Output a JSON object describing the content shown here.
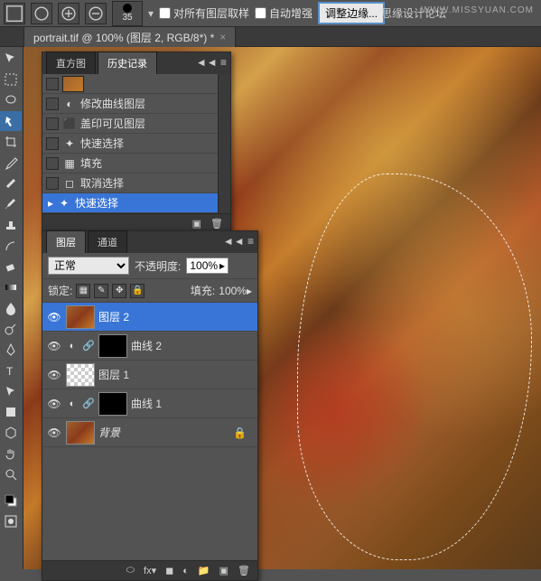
{
  "options_bar": {
    "brush_size": "35",
    "sample_all": "对所有图层取样",
    "auto_enhance": "自动增强",
    "refine_edge": "调整边缘..."
  },
  "document_tab": {
    "title": "portrait.tif @ 100% (图层 2, RGB/8*) *"
  },
  "watermark": {
    "site": "WWW.MISSYUAN.COM",
    "forum": "思缘设计论坛"
  },
  "history_panel": {
    "tabs": [
      "直方图",
      "历史记录"
    ],
    "active_tab": 1,
    "items": [
      {
        "label": "修改曲线图层"
      },
      {
        "label": "盖印可见图层"
      },
      {
        "label": "快速选择"
      },
      {
        "label": "填充"
      },
      {
        "label": "取消选择"
      },
      {
        "label": "快速选择",
        "selected": true
      }
    ]
  },
  "layers_panel": {
    "tabs": [
      "图层",
      "通道"
    ],
    "active_tab": 0,
    "blend_mode": "正常",
    "opacity_label": "不透明度:",
    "opacity_value": "100%",
    "lock_label": "锁定:",
    "fill_label": "填充:",
    "fill_value": "100%",
    "layers": [
      {
        "name": "图层 2",
        "selected": true,
        "thumb": "leaves"
      },
      {
        "name": "曲线 2",
        "adj": true,
        "thumb": "black"
      },
      {
        "name": "图层 1",
        "thumb": "checker"
      },
      {
        "name": "曲线 1",
        "adj": true,
        "thumb": "black"
      },
      {
        "name": "背景",
        "thumb": "leaves",
        "locked": true
      }
    ]
  }
}
